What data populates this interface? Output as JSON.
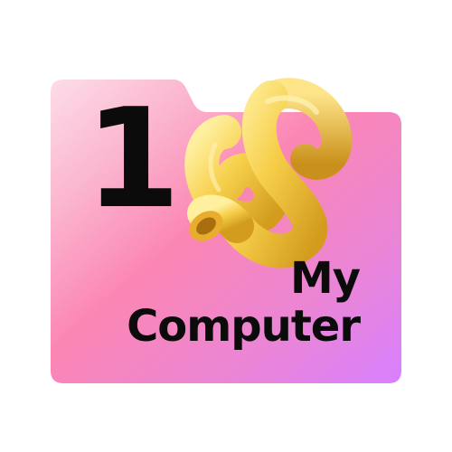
{
  "icon": {
    "number": "1",
    "label_line1": "My",
    "label_line2": "Computer",
    "ribbon_icon": "coiled-noodle-icon",
    "folder_icon": "folder-icon"
  },
  "colors": {
    "folder_top_left": "#fbd3e4",
    "folder_mid": "#fb86b3",
    "folder_bottom_right": "#d97fff",
    "ribbon_light": "#ffe27a",
    "ribbon_mid": "#f2c43c",
    "ribbon_dark": "#c98f18",
    "text": "#0b0b0b"
  }
}
